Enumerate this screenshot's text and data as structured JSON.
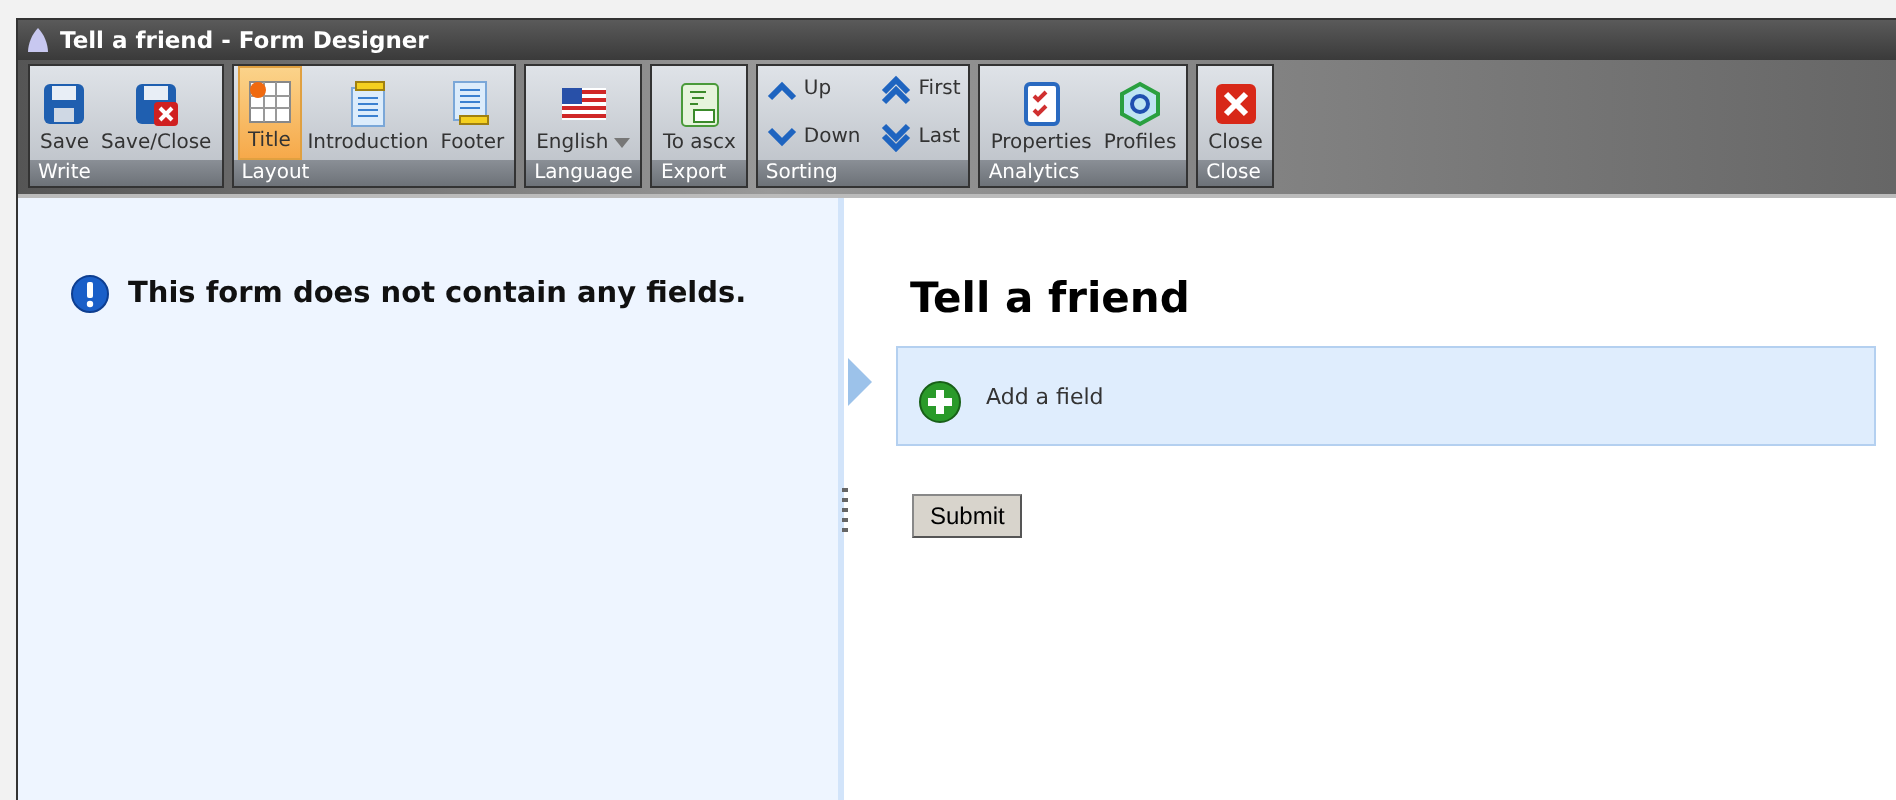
{
  "window": {
    "title": "Tell a friend - Form Designer"
  },
  "toolbar": {
    "groups": [
      {
        "label": "Write",
        "buttons": [
          {
            "label": "Save",
            "kind": "large",
            "selected": false
          },
          {
            "label": "Save/Close",
            "kind": "large",
            "selected": false
          }
        ]
      },
      {
        "label": "Layout",
        "buttons": [
          {
            "label": "Title",
            "kind": "large",
            "selected": true
          },
          {
            "label": "Introduction",
            "kind": "large",
            "selected": false
          },
          {
            "label": "Footer",
            "kind": "large",
            "selected": false
          }
        ]
      },
      {
        "label": "Language",
        "buttons": [
          {
            "label": "English",
            "kind": "dropdown",
            "selected": false
          }
        ]
      },
      {
        "label": "Export",
        "buttons": [
          {
            "label": "To ascx",
            "kind": "large",
            "selected": false
          }
        ]
      },
      {
        "label": "Sorting",
        "buttons": [
          {
            "label": "Up",
            "kind": "small",
            "selected": false
          },
          {
            "label": "Down",
            "kind": "small",
            "selected": false
          },
          {
            "label": "First",
            "kind": "small",
            "selected": false
          },
          {
            "label": "Last",
            "kind": "small",
            "selected": false
          }
        ]
      },
      {
        "label": "Analytics",
        "buttons": [
          {
            "label": "Properties",
            "kind": "large",
            "selected": false
          },
          {
            "label": "Profiles",
            "kind": "large",
            "selected": false
          }
        ]
      },
      {
        "label": "Close",
        "buttons": [
          {
            "label": "Close",
            "kind": "large",
            "selected": false
          }
        ]
      }
    ]
  },
  "fields_panel": {
    "message": "This form does not contain any fields."
  },
  "form_preview": {
    "title": "Tell a friend",
    "add_field": "Add a field",
    "submit": "Submit"
  }
}
